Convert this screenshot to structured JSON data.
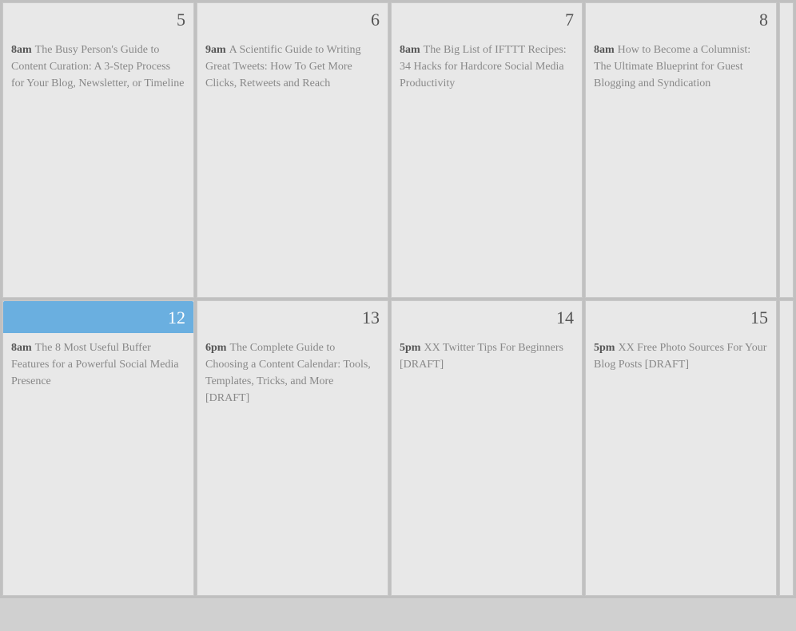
{
  "calendar": {
    "rows": [
      {
        "cells": [
          {
            "day": "5",
            "active": false,
            "event_time": "8am",
            "event_title": "The Busy Person's Guide to Content Curation: A 3-Step Process for Your Blog, Newsletter, or Timeline"
          },
          {
            "day": "6",
            "active": false,
            "event_time": "9am",
            "event_title": "A Scientific Guide to Writing Great Tweets: How To Get More Clicks, Retweets and Reach"
          },
          {
            "day": "7",
            "active": false,
            "event_time": "8am",
            "event_title": "The Big List of IFTTT Recipes: 34 Hacks for Hardcore Social Media Productivity"
          },
          {
            "day": "8",
            "active": false,
            "event_time": "8am",
            "event_title": "How to Become a Columnist: The Ultimate Blueprint for Guest Blogging and Syndication"
          }
        ]
      },
      {
        "cells": [
          {
            "day": "12",
            "active": true,
            "event_time": "8am",
            "event_title": "The 8 Most Useful Buffer Features for a Powerful Social Media Presence"
          },
          {
            "day": "13",
            "active": false,
            "event_time": "6pm",
            "event_title": "The Complete Guide to Choosing a Content Calendar: Tools, Templates, Tricks, and More [DRAFT]"
          },
          {
            "day": "14",
            "active": false,
            "event_time": "5pm",
            "event_title": "XX Twitter Tips For Beginners [DRAFT]"
          },
          {
            "day": "15",
            "active": false,
            "event_time": "5pm",
            "event_title": "XX Free Photo Sources For Your Blog Posts [DRAFT]"
          }
        ]
      }
    ]
  }
}
